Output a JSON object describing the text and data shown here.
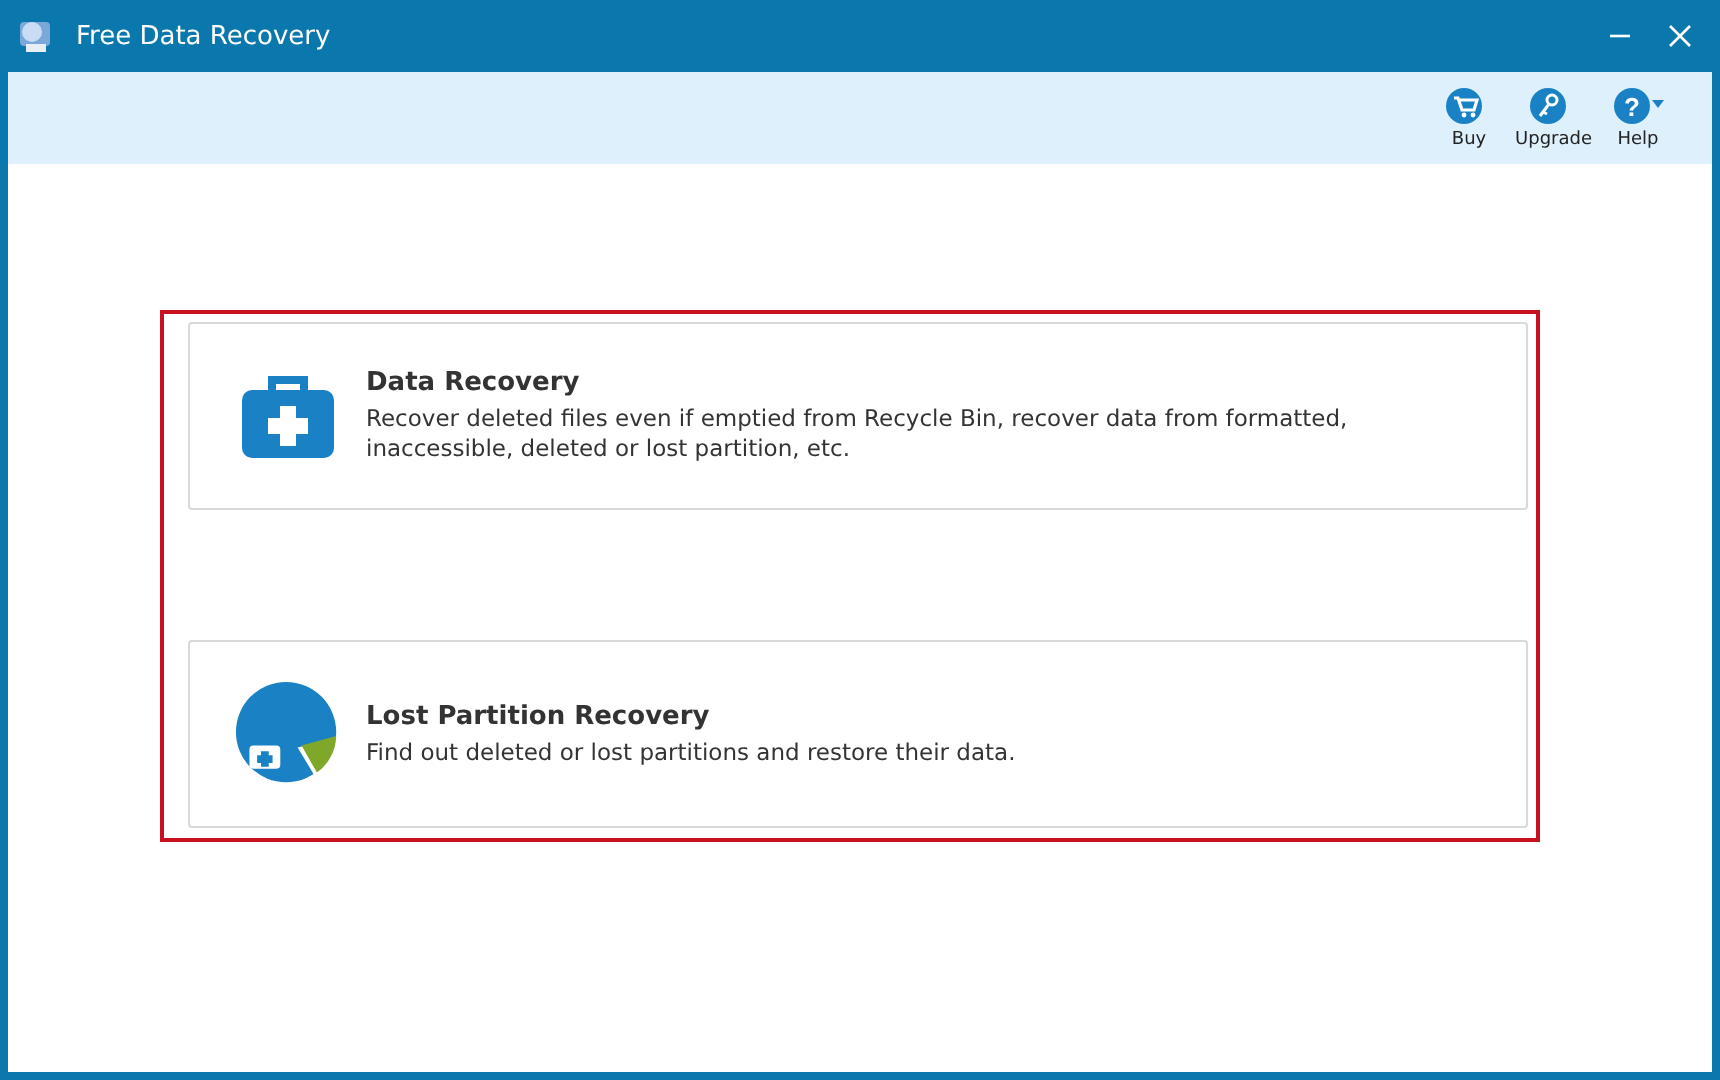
{
  "window": {
    "title": "Free Data Recovery"
  },
  "toolbar": [
    {
      "kind": "cart",
      "label": "Buy"
    },
    {
      "kind": "keys",
      "label": "Upgrade"
    },
    {
      "kind": "help",
      "symbol": "?",
      "label": "Help"
    }
  ],
  "options": [
    {
      "kind": "toolbox",
      "title": "Data Recovery",
      "description": "Recover deleted files even if emptied from Recycle Bin, recover data from formatted, inaccessible, deleted or lost partition, etc."
    },
    {
      "kind": "partition",
      "title": "Lost Partition Recovery",
      "description": "Find out deleted or lost partitions and restore their data."
    }
  ]
}
